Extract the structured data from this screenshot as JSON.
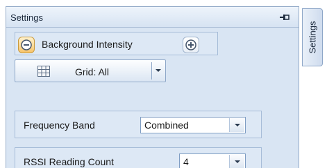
{
  "panel": {
    "title": "Settings"
  },
  "intensity": {
    "label": "Background Intensity",
    "decrease_icon": "minus-circle-icon",
    "increase_icon": "plus-circle-icon"
  },
  "grid": {
    "label": "Grid: All",
    "icon": "grid-icon"
  },
  "frequency_band": {
    "label": "Frequency Band",
    "value": "Combined"
  },
  "rssi_reading_count": {
    "label": "RSSI Reading Count",
    "value": "4"
  },
  "side_tab": {
    "label": "Settings"
  },
  "colors": {
    "panel_bg": "#d9e5f3",
    "border": "#95acc9",
    "accent_orange": "#f7c46b"
  }
}
